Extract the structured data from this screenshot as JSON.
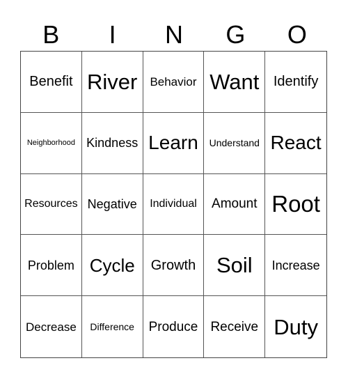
{
  "header": [
    "B",
    "I",
    "N",
    "G",
    "O"
  ],
  "cells": [
    "Benefit",
    "River",
    "Behavior",
    "Want",
    "Identify",
    "Neighborhood",
    "Kindness",
    "Learn",
    "Understand",
    "React",
    "Resources",
    "Negative",
    "Individual",
    "Amount",
    "Root",
    "Problem",
    "Cycle",
    "Growth",
    "Soil",
    "Increase",
    "Decrease",
    "Difference",
    "Produce",
    "Receive",
    "Duty"
  ]
}
